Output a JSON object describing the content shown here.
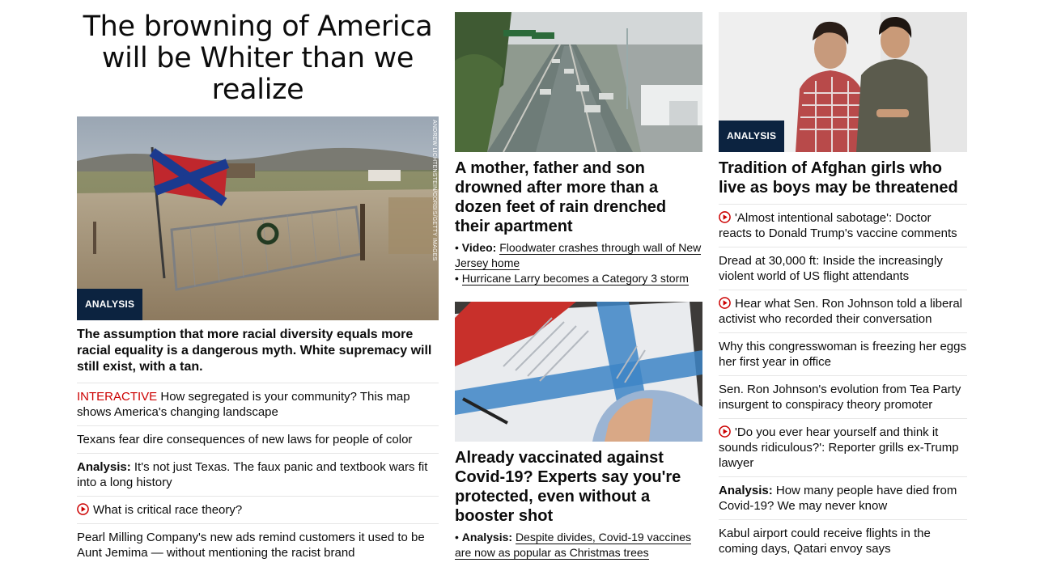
{
  "col1": {
    "headline": "The browning of America will be Whiter than we realize",
    "image_badge": "ANALYSIS",
    "image_credit": "ANDREW LICHTENSTEIN/CORBIS/GETTY IMAGES",
    "dek": "The assumption that more racial diversity equals more racial equality is a dangerous myth. White supremacy will still exist, with a tan.",
    "items": [
      {
        "kicker": "INTERACTIVE",
        "text": " How segregated is your community? This map shows America's changing landscape"
      },
      {
        "text": "Texans fear dire consequences of new laws for people of color"
      },
      {
        "prefix": "Analysis:",
        "text": " It's not just Texas. The faux panic and textbook wars fit into a long history"
      },
      {
        "video": true,
        "text": "What is critical race theory?"
      },
      {
        "text": "Pearl Milling Company's new ads remind customers it used to be Aunt Jemima — without mentioning the racist brand"
      }
    ]
  },
  "col2": {
    "card1": {
      "title": "A mother, father and son drowned after more than a dozen feet of rain drenched their apartment",
      "links": [
        {
          "prefix": "Video:",
          "text": "Floodwater crashes through wall of New Jersey home"
        },
        {
          "prefix": "",
          "text": "Hurricane Larry becomes a Category 3 storm"
        }
      ]
    },
    "card2": {
      "title": "Already vaccinated against Covid-19? Experts say you're protected, even without a booster shot",
      "links": [
        {
          "prefix": "Analysis:",
          "text": "Despite divides, Covid-19 vaccines are now as popular as Christmas trees"
        }
      ]
    }
  },
  "col3": {
    "image_badge": "ANALYSIS",
    "title": "Tradition of Afghan girls who live as boys may be threatened",
    "items": [
      {
        "video": true,
        "text": "'Almost intentional sabotage': Doctor reacts to Donald Trump's vaccine comments"
      },
      {
        "text": "Dread at 30,000 ft: Inside the increasingly violent world of US flight attendants"
      },
      {
        "video": true,
        "text": "Hear what Sen. Ron Johnson told a liberal activist who recorded their conversation"
      },
      {
        "text": "Why this congresswoman is freezing her eggs her first year in office"
      },
      {
        "text": "Sen. Ron Johnson's evolution from Tea Party insurgent to conspiracy theory promoter"
      },
      {
        "video": true,
        "text": "'Do you ever hear yourself and think it sounds ridiculous?': Reporter grills ex-Trump lawyer"
      },
      {
        "prefix": "Analysis:",
        "text": " How many people have died from Covid-19? We may never know"
      },
      {
        "text": "Kabul airport could receive flights in the coming days, Qatari envoy says"
      }
    ]
  },
  "colors": {
    "badge": "#0c2340",
    "kicker": "#cc0000",
    "play": "#cc0000",
    "divider": "#e6e6e6"
  }
}
